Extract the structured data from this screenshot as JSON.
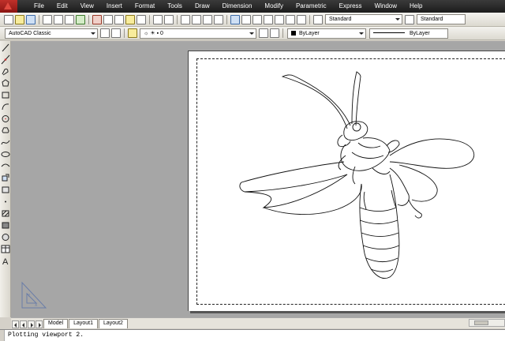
{
  "menubar": {
    "items": [
      "File",
      "Edit",
      "View",
      "Insert",
      "Format",
      "Tools",
      "Draw",
      "Dimension",
      "Modify",
      "Parametric",
      "Express",
      "Window",
      "Help"
    ]
  },
  "styles_toolbar": {
    "text_style": "Standard",
    "dim_style": "Standard"
  },
  "workspace_toolbar": {
    "workspace": "AutoCAD Classic",
    "layer_value": "0",
    "color_value": "ByLayer",
    "linetype_value": "ByLayer"
  },
  "layout_tabs": [
    "Model",
    "Layout1",
    "Layout2"
  ],
  "active_tab": "Layout1",
  "command_line": {
    "text": "Plotting viewport 2."
  },
  "colors": {
    "menubar": "#2a2a2a",
    "model_space": "#a6a6a6",
    "paper": "#ffffff",
    "brand_red": "#c0302a"
  }
}
